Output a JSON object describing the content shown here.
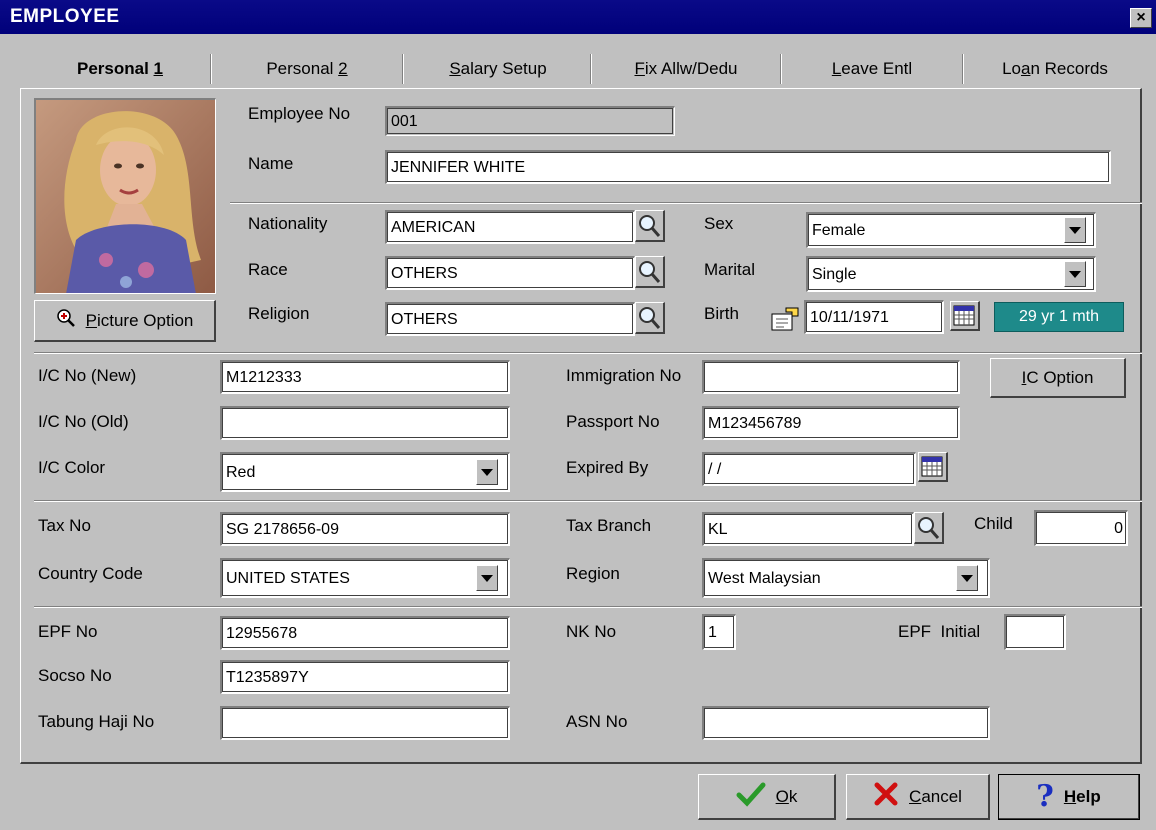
{
  "window": {
    "title": "EMPLOYEE",
    "close": "×"
  },
  "tabs": [
    {
      "label": "Personal 1",
      "mnemonic": "1",
      "prefix": "Personal ",
      "suffix": ""
    },
    {
      "label": "Personal 2",
      "mnemonic": "2",
      "prefix": "Personal ",
      "suffix": ""
    },
    {
      "label": "Salary Setup",
      "mnemonic": "S",
      "prefix": "",
      "suffix": "alary Setup"
    },
    {
      "label": "Fix Allw/Dedu",
      "mnemonic": "F",
      "prefix": "",
      "suffix": "ix Allw/Dedu"
    },
    {
      "label": "Leave Entl",
      "mnemonic": "L",
      "prefix": "",
      "suffix": "eave Entl"
    },
    {
      "label": "Loan Records",
      "mnemonic": "a",
      "prefix": "Lo",
      "suffix": "n Records"
    }
  ],
  "photo": {
    "button_label": "Picture Option",
    "mnemonic": "P",
    "suffix": "icture Option"
  },
  "employee_no": {
    "label": "Employee No",
    "value": "001"
  },
  "name": {
    "label": "Name",
    "value": "JENNIFER WHITE"
  },
  "nationality": {
    "label": "Nationality",
    "value": "AMERICAN"
  },
  "race": {
    "label": "Race",
    "value": "OTHERS"
  },
  "religion": {
    "label": "Religion",
    "value": "OTHERS"
  },
  "sex": {
    "label": "Sex",
    "value": "Female"
  },
  "marital": {
    "label": "Marital",
    "value": "Single"
  },
  "birth": {
    "label": "Birth",
    "value": "10/11/1971",
    "age": "29 yr 1 mth"
  },
  "ic_new": {
    "label": "I/C No (New)",
    "value": "M1212333"
  },
  "ic_old": {
    "label": "I/C No (Old)",
    "value": ""
  },
  "ic_color": {
    "label": "I/C Color",
    "value": "Red"
  },
  "immigration_no": {
    "label": "Immigration No",
    "value": ""
  },
  "ic_option": {
    "label": "IC Option",
    "mnemonic": "I",
    "suffix": "C Option"
  },
  "passport_no": {
    "label": "Passport No",
    "value": "M123456789"
  },
  "expired_by": {
    "label": "Expired By",
    "value": " / /"
  },
  "tax_no": {
    "label": "Tax No",
    "value": "SG 2178656-09"
  },
  "country_code": {
    "label": "Country Code",
    "value": "UNITED STATES"
  },
  "tax_branch": {
    "label": "Tax Branch",
    "value": "KL"
  },
  "child": {
    "label": "Child",
    "value": "0"
  },
  "region": {
    "label": "Region",
    "value": "West Malaysian"
  },
  "epf_no": {
    "label": "EPF No",
    "value": "12955678"
  },
  "nk_no": {
    "label": "NK No",
    "value": "1"
  },
  "epf_initial": {
    "label": "EPF  Initial",
    "value": ""
  },
  "socso_no": {
    "label": "Socso No",
    "value": "T1235897Y"
  },
  "tabung_haji_no": {
    "label": "Tabung Haji No",
    "value": ""
  },
  "asn_no": {
    "label": "ASN No",
    "value": ""
  },
  "buttons": {
    "ok": {
      "label": "Ok",
      "mnemonic": "O",
      "suffix": "k"
    },
    "cancel": {
      "label": "Cancel",
      "mnemonic": "C",
      "suffix": "ancel"
    },
    "help": {
      "label": "Help",
      "mnemonic": "H",
      "suffix": "elp"
    }
  },
  "colors": {
    "title_bar": "#00007a",
    "age_badge": "#1e8a8a",
    "window_bg": "#c0c0c0"
  },
  "icons": [
    "search-icon",
    "calendar-icon",
    "zoom-icon",
    "check-icon",
    "cross-icon",
    "question-icon",
    "birth-lookup-icon"
  ]
}
